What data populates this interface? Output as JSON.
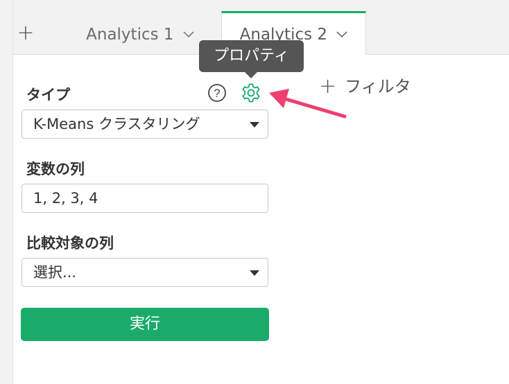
{
  "tabs": {
    "add_label": "+",
    "items": [
      {
        "label": "Analytics 1"
      },
      {
        "label": "Analytics 2"
      }
    ],
    "active_color": "#1aab6a"
  },
  "tooltip": {
    "text": "プロパティ"
  },
  "filter": {
    "plus": "+",
    "label": "フィルタ"
  },
  "form": {
    "type_label": "タイプ",
    "type_value": "K-Means クラスタリング",
    "vars_label": "変数の列",
    "vars_value": "1, 2, 3, 4",
    "compare_label": "比較対象の列",
    "compare_value": "選択...",
    "run_label": "実行"
  },
  "icons": {
    "help": "help-icon",
    "settings": "gear-icon",
    "pointer": "pointer-arrow-icon",
    "dropdown": "chevron-down-icon"
  },
  "colors": {
    "accent": "#1aab6a",
    "pointer": "#f03e6e",
    "tooltip_bg": "#555555"
  }
}
